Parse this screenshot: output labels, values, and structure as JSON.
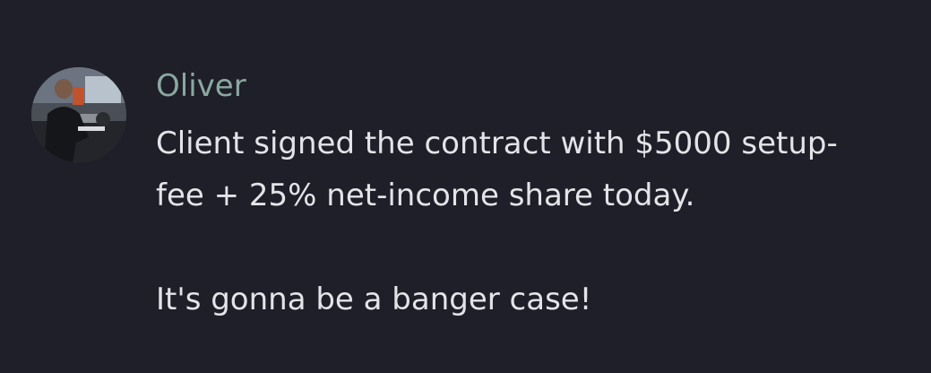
{
  "message": {
    "author": "Oliver",
    "lines": [
      "Client signed the contract with $5000 setup-",
      "fee + 25% net-income share today.",
      "",
      "It's gonna be a banger case!"
    ]
  },
  "colors": {
    "background": "#1e1f28",
    "author_name": "#8aa8a0",
    "message_text": "#e3e4e8"
  },
  "icons": {
    "avatar": "profile-photo"
  }
}
